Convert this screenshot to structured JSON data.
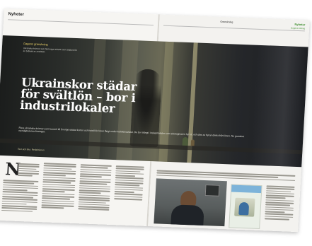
{
  "left_page": {
    "section": "Nyheter",
    "kicker_label": "Dagens granskning",
    "kicker_text": "Ukrainska kvinnor som flytt kriget arbetar som städare för en bråkdel av avtalslön.",
    "headline": "Ukrainskor städar för svältlön – bor i industrilokaler",
    "ingress": "Flera ukrainska kvinnor som kommit till Sverige städar kontor och hotell för löner långt under kollektivavtalet. De bor trångt i industrilokaler som arbetsgivaren hyr ut, och drar av hyran direkt från lönen. Nu granskar myndigheterna företaget.",
    "byline": "Text och foto: Redaktionen"
  },
  "right_page": {
    "topic": "Granskning",
    "brand": "Nyheter",
    "brand_sub": "Dagens tidning"
  }
}
